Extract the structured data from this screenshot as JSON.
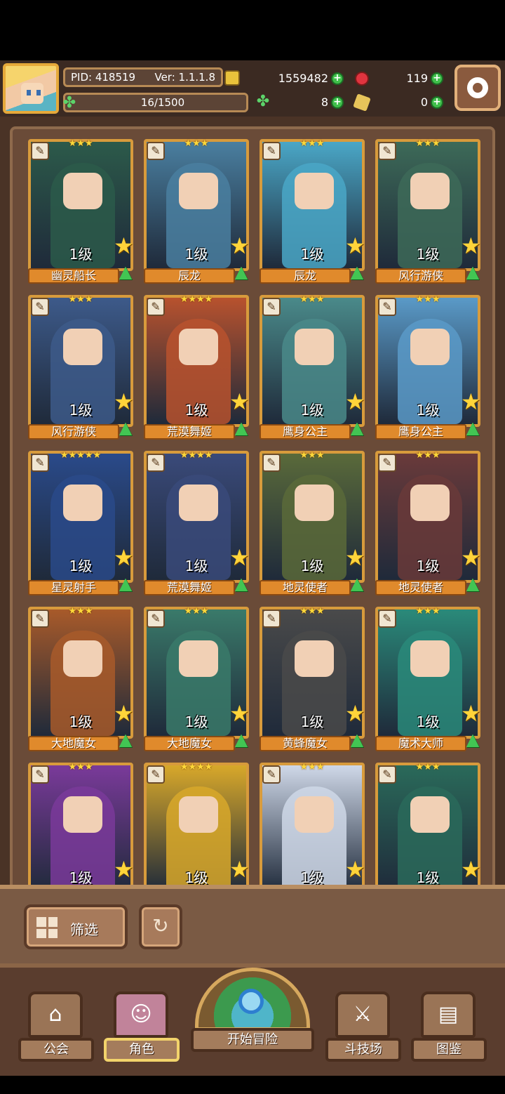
{
  "header": {
    "pid": "PID: 418519",
    "version": "Ver: 1.1.1.8",
    "level_progress": "16/1500",
    "gold": "1559482",
    "gems": "119",
    "clovers": "8",
    "tickets": "0"
  },
  "cards": [
    {
      "name": "幽灵船长",
      "level": "1级",
      "stars": "★★★",
      "accent": "#2c5a4a"
    },
    {
      "name": "辰龙",
      "level": "1级",
      "stars": "★★★",
      "accent": "#4a7fa0"
    },
    {
      "name": "辰龙",
      "level": "1级",
      "stars": "★★★",
      "accent": "#4aa7c7"
    },
    {
      "name": "风行游侠",
      "level": "1级",
      "stars": "★★★",
      "accent": "#3d6a58"
    },
    {
      "name": "风行游侠",
      "level": "1级",
      "stars": "★★★",
      "accent": "#3d5a8a"
    },
    {
      "name": "荒漠舞姬",
      "level": "1级",
      "stars": "★★★★",
      "accent": "#b8522e"
    },
    {
      "name": "鹰身公主",
      "level": "1级",
      "stars": "★★★",
      "accent": "#4a8a8a"
    },
    {
      "name": "鹰身公主",
      "level": "1级",
      "stars": "★★★",
      "accent": "#5a9ac8"
    },
    {
      "name": "星灵射手",
      "level": "1级",
      "stars": "★★★★★",
      "accent": "#2a4a8a"
    },
    {
      "name": "荒漠舞姬",
      "level": "1级",
      "stars": "★★★★",
      "accent": "#3a4a7a"
    },
    {
      "name": "地灵使者",
      "level": "1级",
      "stars": "★★★",
      "accent": "#5a6a3a"
    },
    {
      "name": "地灵使者",
      "level": "1级",
      "stars": "★★★",
      "accent": "#6a3a3a"
    },
    {
      "name": "大地魔女",
      "level": "1级",
      "stars": "★★★",
      "accent": "#a85a2a"
    },
    {
      "name": "大地魔女",
      "level": "1级",
      "stars": "★★★",
      "accent": "#3a7a6a"
    },
    {
      "name": "黄蜂魔女",
      "level": "1级",
      "stars": "★★★",
      "accent": "#4a4a4a"
    },
    {
      "name": "魔术大师",
      "level": "1级",
      "stars": "★★★",
      "accent": "#2a8a7a"
    },
    {
      "name": "",
      "level": "1级",
      "stars": "★★★",
      "accent": "#7a3a9a"
    },
    {
      "name": "",
      "level": "1级",
      "stars": "★★★★",
      "accent": "#d8a82a"
    },
    {
      "name": "",
      "level": "1级",
      "stars": "★★★",
      "accent": "#cfd8e8"
    },
    {
      "name": "",
      "level": "1级",
      "stars": "★★★",
      "accent": "#2a6a5a"
    }
  ],
  "filter": {
    "label": "筛选"
  },
  "nav": {
    "guild": "公会",
    "character": "角色",
    "adventure": "开始冒险",
    "arena": "斗技场",
    "codex": "图鉴"
  },
  "colors": {
    "frame_gold": "#d89b3c",
    "nameplate": "#e08a2c",
    "panel_bg": "#6a4b38"
  }
}
